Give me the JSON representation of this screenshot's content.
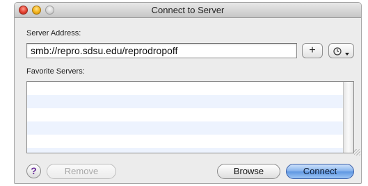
{
  "window": {
    "title": "Connect to Server"
  },
  "server_address": {
    "label": "Server Address:",
    "value": "smb://repro.sdsu.edu/reprodropoff",
    "add_button_label": "+",
    "recent_icon": "clock-icon",
    "recent_dropdown_icon": "chevron-down-icon"
  },
  "favorites": {
    "label": "Favorite Servers:",
    "items": []
  },
  "footer": {
    "help_label": "?",
    "remove_label": "Remove",
    "browse_label": "Browse",
    "connect_label": "Connect"
  },
  "colors": {
    "close": "#e2402f",
    "minimize": "#f2b31c",
    "zoom": "#d4d4d4",
    "default_button": "#6fa3e7",
    "list_alt_row": "#edf3fe",
    "help_glyph": "#6a2d9a"
  }
}
